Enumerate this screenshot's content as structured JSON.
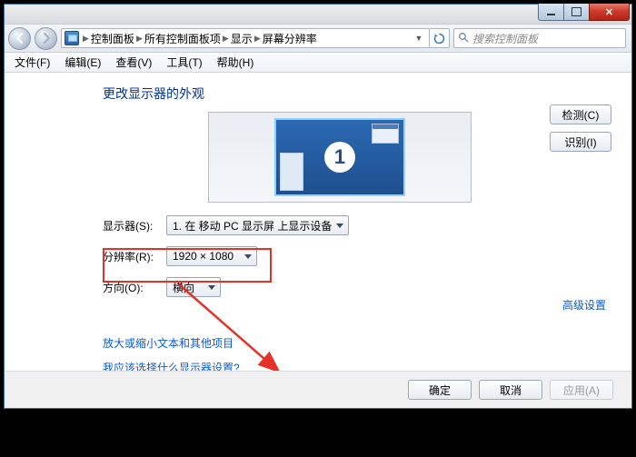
{
  "titlebar": {},
  "nav": {
    "breadcrumb": [
      "控制面板",
      "所有控制面板项",
      "显示",
      "屏幕分辨率"
    ]
  },
  "search": {
    "placeholder": "搜索控制面板"
  },
  "menus": {
    "file": "文件(F)",
    "edit": "编辑(E)",
    "view": "查看(V)",
    "tools": "工具(T)",
    "help": "帮助(H)"
  },
  "heading": "更改显示器的外观",
  "monitor": {
    "number": "1"
  },
  "buttons": {
    "detect": "检测(C)",
    "identify": "识别(I)",
    "ok": "确定",
    "cancel": "取消",
    "apply": "应用(A)"
  },
  "labels": {
    "display": "显示器(S):",
    "resolution": "分辨率(R):",
    "orientation": "方向(O):"
  },
  "values": {
    "display": "1. 在 移动 PC 显示屏 上显示设备",
    "resolution": "1920 × 1080",
    "orientation": "横向"
  },
  "links": {
    "advanced": "高级设置",
    "textsize": "放大或缩小文本和其他项目",
    "whatdisplay": "我应该选择什么显示器设置?"
  }
}
